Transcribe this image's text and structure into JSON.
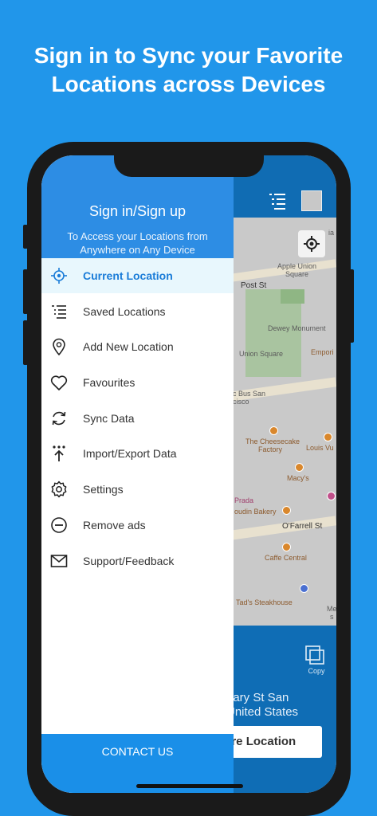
{
  "headline": {
    "line1": "Sign in to Sync your Favorite",
    "line2": "Locations across Devices"
  },
  "drawer": {
    "title": "Sign in/Sign up",
    "subtitle_line1": "To Access your Locations from",
    "subtitle_line2": "Anywhere on Any Device",
    "items": [
      {
        "label": "Current Location",
        "icon": "target-icon",
        "active": true
      },
      {
        "label": "Saved Locations",
        "icon": "list-icon"
      },
      {
        "label": "Add New Location",
        "icon": "pin-add-icon"
      },
      {
        "label": "Favourites",
        "icon": "heart-icon"
      },
      {
        "label": "Sync Data",
        "icon": "sync-icon"
      },
      {
        "label": "Import/Export Data",
        "icon": "import-export-icon"
      },
      {
        "label": "Settings",
        "icon": "gear-icon"
      },
      {
        "label": "Remove ads",
        "icon": "minus-circle-icon"
      },
      {
        "label": "Support/Feedback",
        "icon": "mail-icon"
      }
    ],
    "contact_label": "CONTACT US"
  },
  "map": {
    "labels": {
      "apple_union_1": "Apple Union",
      "apple_union_2": "Square",
      "post_st": "Post St",
      "dewey": "Dewey Monument",
      "union_square": "Union Square",
      "emporio": "Empori",
      "bus_1": "c Bus San",
      "bus_2": "cisco",
      "cheesecake_1": "The Cheesecake",
      "cheesecake_2": "Factory",
      "louis": "Louis Vu",
      "macys": "Macy's",
      "prada": "Prada",
      "boudin": "oudin Bakery",
      "ofarrell": "O'Farrell St",
      "caffe": "Caffe Central",
      "tads": "Tad's Steakhouse",
      "me": "Me",
      "s": "s",
      "ia": "ia"
    }
  },
  "bottom": {
    "address_line1": "eary St San",
    "address_line2": "United States",
    "share_label": "are Location",
    "copy_label": "Copy"
  },
  "colors": {
    "background": "#2196ea",
    "drawer_header": "#2d8de4",
    "active_text": "#1a7cd8",
    "contact_bg": "#1a8fe8"
  }
}
